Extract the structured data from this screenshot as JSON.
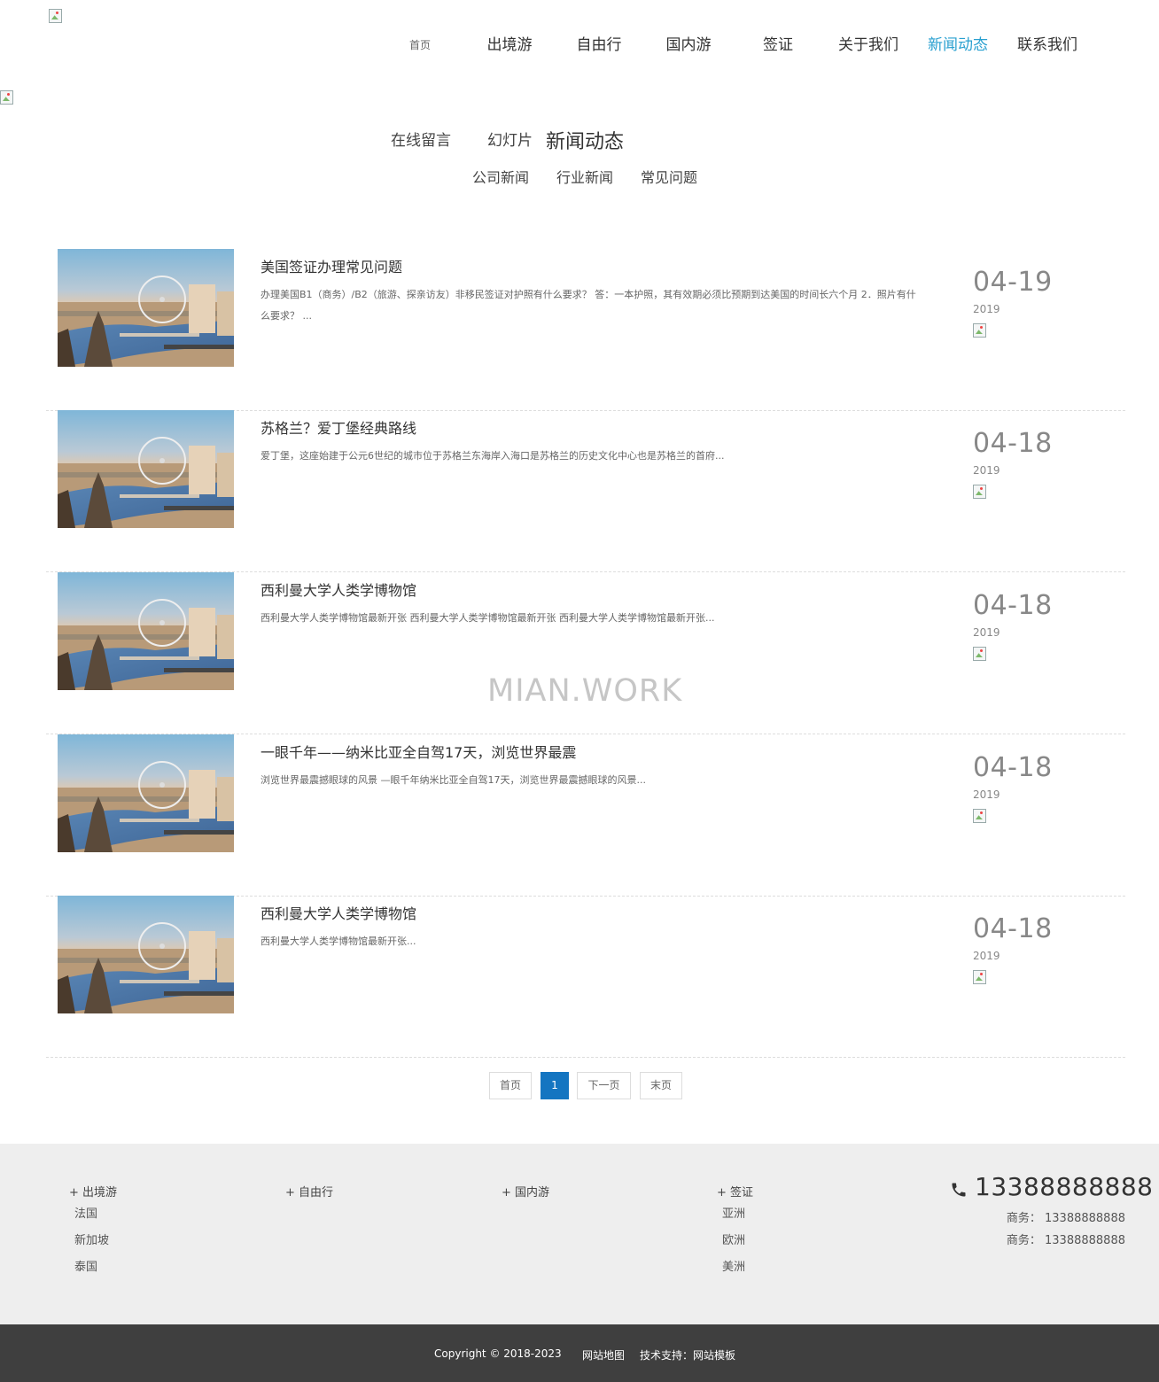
{
  "header": {
    "nav": [
      {
        "label": "首页",
        "active": false
      },
      {
        "label": "出境游",
        "active": false
      },
      {
        "label": "自由行",
        "active": false
      },
      {
        "label": "国内游",
        "active": false
      },
      {
        "label": "签证",
        "active": false
      },
      {
        "label": "关于我们",
        "active": false
      },
      {
        "label": "新闻动态",
        "active": true
      },
      {
        "label": "联系我们",
        "active": false
      }
    ],
    "active_color": "#29a0d0"
  },
  "categories": {
    "items": [
      "在线留言",
      "幻灯片",
      "新闻动态"
    ],
    "current": "新闻动态",
    "sub": [
      "公司新闻",
      "行业新闻",
      "常见问题"
    ]
  },
  "news": [
    {
      "title": "美国签证办理常见问题",
      "summary": "办理美国B1（商务）/B2（旅游、探亲访友）非移民签证对护照有什么要求？ 答：一本护照，其有效期必须比预期到达美国的时间长六个月 2．照片有什么要求？ ...",
      "day": "04-19",
      "year": "2019"
    },
    {
      "title": "苏格兰？爱丁堡经典路线",
      "summary": "爱丁堡，这座始建于公元6世纪的城市位于苏格兰东海岸入海口是苏格兰的历史文化中心也是苏格兰的首府...",
      "day": "04-18",
      "year": "2019"
    },
    {
      "title": "西利曼大学人类学博物馆",
      "summary": "西利曼大学人类学博物馆最新开张 西利曼大学人类学博物馆最新开张 西利曼大学人类学博物馆最新开张...",
      "day": "04-18",
      "year": "2019"
    },
    {
      "title": "一眼千年——纳米比亚全自驾17天，浏览世界最震",
      "summary": "浏览世界最震撼眼球的风景 —眼千年纳米比亚全自驾17天，浏览世界最震撼眼球的风景...",
      "day": "04-18",
      "year": "2019"
    },
    {
      "title": "西利曼大学人类学博物馆",
      "summary": "西利曼大学人类学博物馆最新开张...",
      "day": "04-18",
      "year": "2019"
    }
  ],
  "pagination": {
    "first": "首页",
    "current": "1",
    "next": "下一页",
    "last": "末页",
    "accent": "#1475c1"
  },
  "watermark": "MIAN.WORK",
  "footer": {
    "columns": [
      {
        "head": "+ 出境游",
        "links": [
          "法国",
          "新加坡",
          "泰国"
        ]
      },
      {
        "head": "+ 自由行",
        "links": []
      },
      {
        "head": "+ 国内游",
        "links": []
      },
      {
        "head": "+ 签证",
        "links": [
          "亚洲",
          "欧洲",
          "美洲"
        ]
      }
    ],
    "phone_main": "13388888888",
    "phone_lines": [
      "商务：  13388888888",
      "商务：  13388888888"
    ],
    "phone_icon": "phone-icon",
    "copyright": "Copyright © 2018-2023",
    "sitemap": "网站地图",
    "support": "技术支持：网站模板"
  }
}
